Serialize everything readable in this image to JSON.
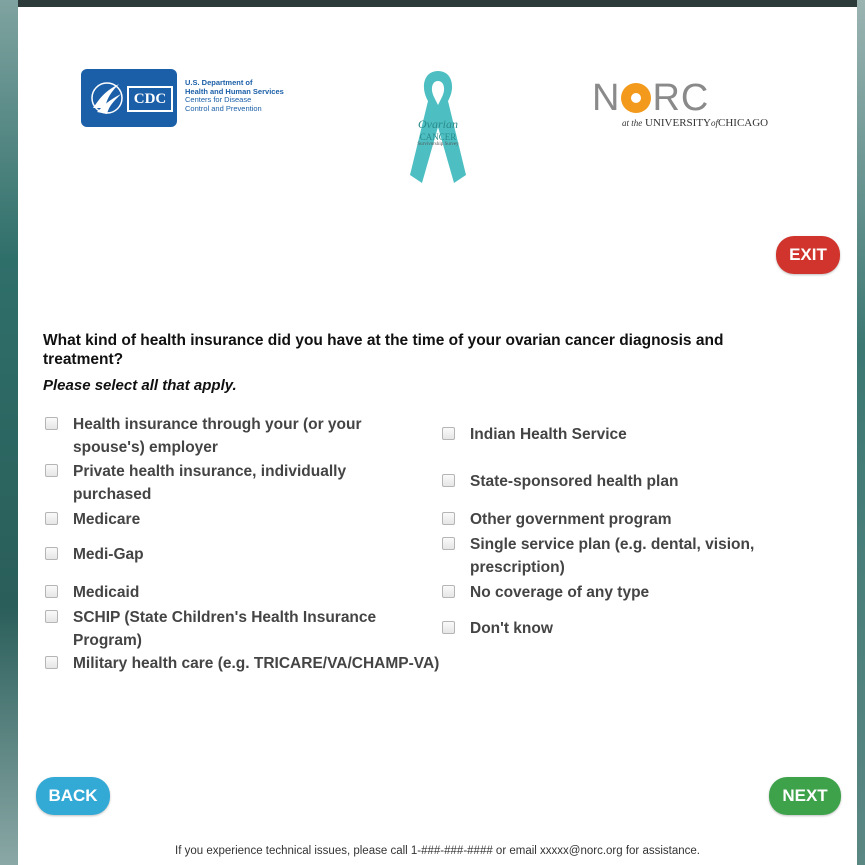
{
  "header": {
    "cdc": {
      "abbr": "CDC",
      "line1": "U.S. Department of",
      "line2": "Health and Human Services",
      "line3": "Centers for Disease",
      "line4": "Control and Prevention"
    },
    "survey_logo": {
      "line1": "Ovarian",
      "line2": "CANCER",
      "line3": "Survivorship Survey",
      "ribbon_color": "#4dbfc2"
    },
    "norc": {
      "n": "N",
      "rc": "RC",
      "sub_prefix": "at the",
      "sub_main": "UNIVERSITY",
      "sub_of": "of",
      "sub_end": "CHICAGO"
    }
  },
  "buttons": {
    "exit": "EXIT",
    "back": "BACK",
    "next": "NEXT"
  },
  "colors": {
    "exit": "#d0342c",
    "back": "#33a9d6",
    "next": "#3ea24a"
  },
  "question": {
    "text": "What kind of health insurance did you have at the time of your ovarian cancer diagnosis and treatment?",
    "instruction": "Please select all that apply."
  },
  "options_left": [
    {
      "label": "Health insurance through your (or your spouse's) employer",
      "checked": false
    },
    {
      "label": "Private health insurance, individually purchased",
      "checked": false
    },
    {
      "label": "Medicare",
      "checked": false
    },
    {
      "label": "Medi-Gap",
      "checked": false
    },
    {
      "label": "Medicaid",
      "checked": false
    },
    {
      "label": "SCHIP (State Children's Health Insurance Program)",
      "checked": false
    },
    {
      "label": "Military health care (e.g. TRICARE/VA/CHAMP-VA)",
      "checked": false
    }
  ],
  "options_right": [
    {
      "label": "Indian Health Service",
      "checked": false
    },
    {
      "label": "State-sponsored health plan",
      "checked": false
    },
    {
      "label": "Other government program",
      "checked": false
    },
    {
      "label": "Single service plan (e.g. dental, vision, prescription)",
      "checked": false
    },
    {
      "label": "No coverage of any type",
      "checked": false
    },
    {
      "label": "Don't know",
      "checked": false
    }
  ],
  "footer": {
    "text": "If you experience technical issues, please call 1-###-###-#### or email xxxxx@norc.org for assistance."
  }
}
